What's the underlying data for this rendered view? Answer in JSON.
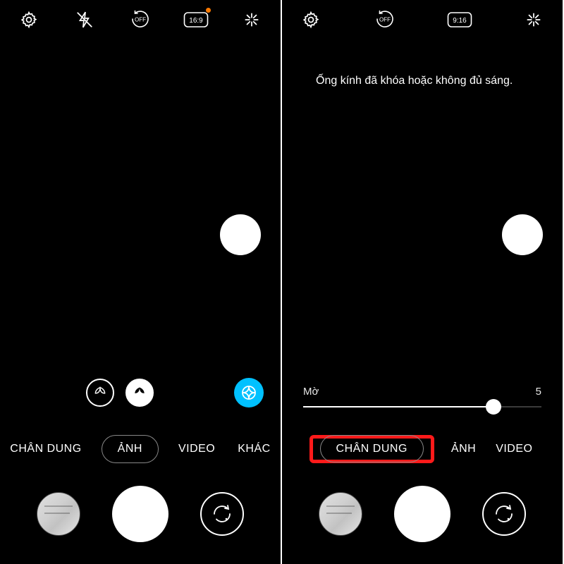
{
  "left": {
    "topbar": {
      "settings": "settings",
      "flash": "flash-off",
      "timer": "OFF",
      "ratio": "16:9",
      "magic": "magic-wand",
      "has_orange_dot": true
    },
    "filters": {
      "leaf1": "leaf-outline",
      "leaf2": "leaf-fill",
      "effects": "aperture"
    },
    "modes": [
      "CHÂN DUNG",
      "ẢNH",
      "VIDEO",
      "KHÁC"
    ],
    "selected_mode_index": 1,
    "bottom": {
      "gallery": "gallery",
      "shutter": "shutter",
      "switch": "switch-camera"
    }
  },
  "right": {
    "topbar": {
      "settings": "settings",
      "timer": "OFF",
      "ratio": "9:16",
      "magic": "magic-wand"
    },
    "hint": "Ống kính đã khóa hoặc không đủ sáng.",
    "blur": {
      "label_left": "Mờ",
      "label_right": "5",
      "value_pct": 80
    },
    "modes": [
      "CHÂN DUNG",
      "ẢNH",
      "VIDEO"
    ],
    "selected_mode_index": 0,
    "highlight_selected": true,
    "bottom": {
      "gallery": "gallery",
      "shutter": "shutter",
      "switch": "switch-camera"
    }
  }
}
